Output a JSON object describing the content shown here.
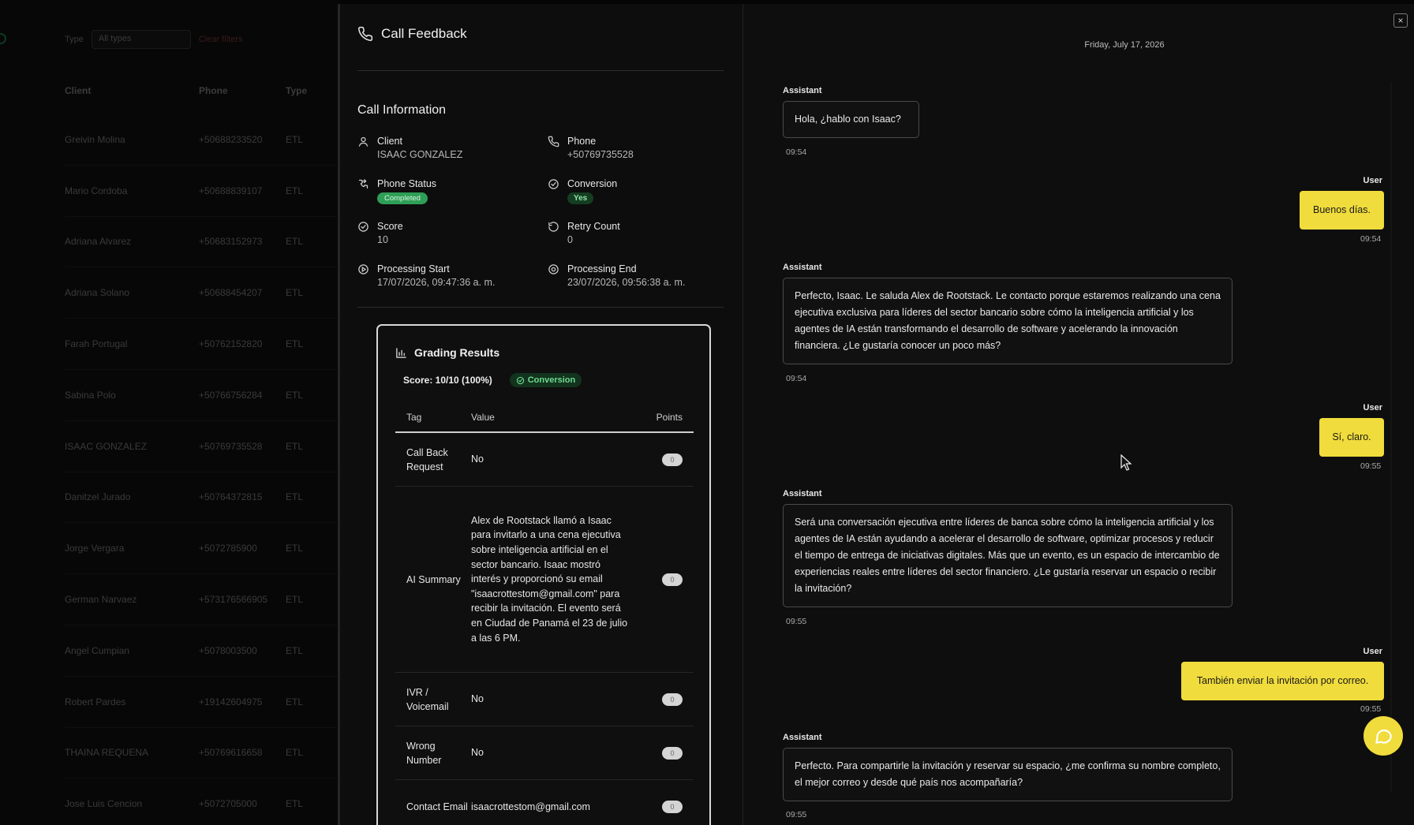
{
  "background": {
    "filter_label": "Type",
    "filter_value": "All types",
    "clear_label": "Clear filters",
    "columns": [
      "Client",
      "Phone",
      "Type"
    ],
    "rows": [
      {
        "client": "Greivin Molina",
        "phone": "+50688233520",
        "type": "ETL"
      },
      {
        "client": "Mario Cordoba",
        "phone": "+50688839107",
        "type": "ETL"
      },
      {
        "client": "Adriana Alvarez",
        "phone": "+50683152973",
        "type": "ETL"
      },
      {
        "client": "Adriana Solano",
        "phone": "+50688454207",
        "type": "ETL"
      },
      {
        "client": "Farah Portugal",
        "phone": "+50762152820",
        "type": "ETL"
      },
      {
        "client": "Sabina Polo",
        "phone": "+50766756284",
        "type": "ETL"
      },
      {
        "client": "ISAAC GONZALEZ",
        "phone": "+50769735528",
        "type": "ETL"
      },
      {
        "client": "Danitzel Jurado",
        "phone": "+50764372815",
        "type": "ETL"
      },
      {
        "client": "Jorge Vergara",
        "phone": "+5072785900",
        "type": "ETL"
      },
      {
        "client": "German Narvaez",
        "phone": "+573176566905",
        "type": "ETL"
      },
      {
        "client": "Angel Cumpian",
        "phone": "+5078003500",
        "type": "ETL"
      },
      {
        "client": "Robert Pardes",
        "phone": "+19142604975",
        "type": "ETL"
      },
      {
        "client": "THAINA REQUENA",
        "phone": "+50769616658",
        "type": "ETL"
      },
      {
        "client": "Jose Luis Cencion",
        "phone": "+5072705000",
        "type": "ETL"
      }
    ]
  },
  "feedback": {
    "title": "Call Feedback",
    "info_title": "Call Information",
    "client_label": "Client",
    "client_value": "ISAAC GONZALEZ",
    "phone_label": "Phone",
    "phone_value": "+50769735528",
    "phone_status_label": "Phone Status",
    "phone_status_value": "Completed",
    "conversion_label": "Conversion",
    "conversion_value": "Yes",
    "score_label": "Score",
    "score_value": "10",
    "retry_label": "Retry Count",
    "retry_value": "0",
    "start_label": "Processing Start",
    "start_value": "17/07/2026, 09:47:36 a. m.",
    "end_label": "Processing End",
    "end_value": "23/07/2026, 09:56:38 a. m."
  },
  "grading": {
    "title": "Grading Results",
    "score_text": "Score: 10/10 (100%)",
    "conversion_badge": "Conversion",
    "columns": {
      "tag": "Tag",
      "value": "Value",
      "points": "Points"
    },
    "rows": [
      {
        "tag": "Call Back Request",
        "value": "No",
        "points": "0"
      },
      {
        "tag": "AI Summary",
        "value": "Alex de Rootstack llamó a Isaac para invitarlo a una cena ejecutiva sobre inteligencia artificial en el sector bancario. Isaac mostró interés y proporcionó su email \"isaacrottestom@gmail.com\" para recibir la invitación. El evento será en Ciudad de Panamá el 23 de julio a las 6 PM.",
        "points": "0"
      },
      {
        "tag": "IVR / Voicemail",
        "value": "No",
        "points": "0"
      },
      {
        "tag": "Wrong Number",
        "value": "No",
        "points": "0"
      },
      {
        "tag": "Contact Email",
        "value": "isaacrottestom@gmail.com",
        "points": "0"
      }
    ]
  },
  "chat": {
    "date": "Friday, July 17, 2026",
    "close_label": "×",
    "messages": [
      {
        "role": "Assistant",
        "text": "Hola, ¿hablo con Isaac?",
        "time": "09:54"
      },
      {
        "role": "User",
        "text": "Buenos días.",
        "time": "09:54"
      },
      {
        "role": "Assistant",
        "text": "Perfecto, Isaac. Le saluda Alex de Rootstack. Le contacto porque estaremos realizando una cena ejecutiva exclusiva para líderes del sector bancario sobre cómo la inteligencia artificial y los agentes de IA están transformando el desarrollo de software y acelerando la innovación financiera. ¿Le gustaría conocer un poco más?",
        "time": "09:54"
      },
      {
        "role": "User",
        "text": "Sí, claro.",
        "time": "09:55"
      },
      {
        "role": "Assistant",
        "text": "Será una conversación ejecutiva entre líderes de banca sobre cómo la inteligencia artificial y los agentes de IA están ayudando a acelerar el desarrollo de software, optimizar procesos y reducir el tiempo de entrega de iniciativas digitales. Más que un evento, es un espacio de intercambio de experiencias reales entre líderes del sector financiero. ¿Le gustaría reservar un espacio o recibir la invitación?",
        "time": "09:55"
      },
      {
        "role": "User",
        "text": "También enviar la invitación por correo.",
        "time": "09:55"
      },
      {
        "role": "Assistant",
        "text": "Perfecto. Para compartirle la invitación y reservar su espacio, ¿me confirma su nombre completo, el mejor correo y desde qué país nos acompañaría?",
        "time": "09:55"
      }
    ]
  },
  "colors": {
    "accent_yellow": "#f0dc3c",
    "success_green": "#2f9e57",
    "panel_bg": "#0d0d0d"
  }
}
